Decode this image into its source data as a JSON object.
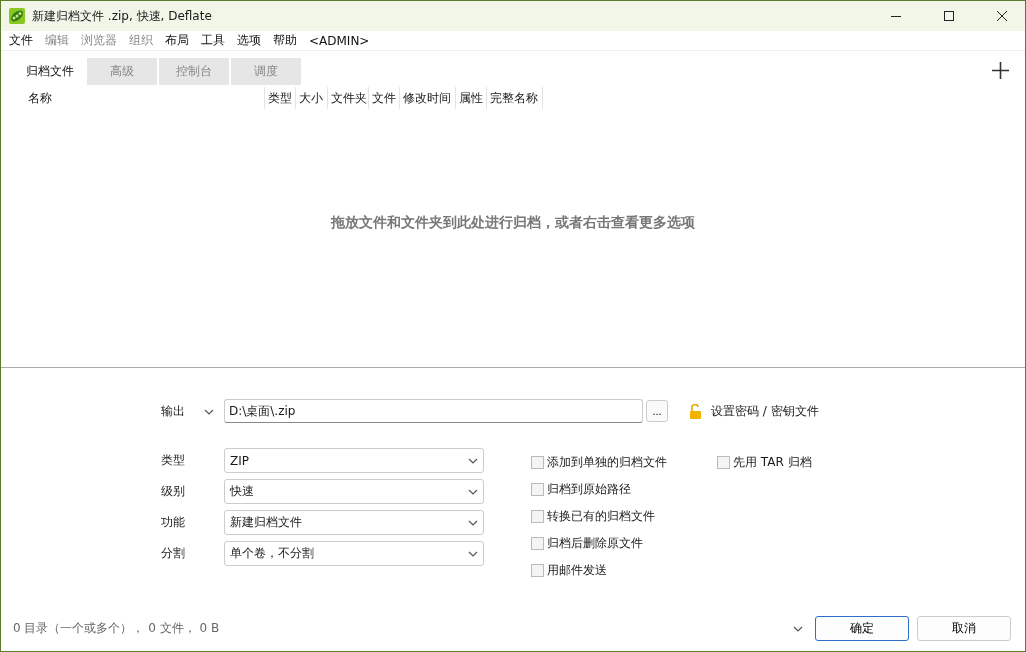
{
  "window": {
    "title": "新建归档文件 .zip, 快速, Deflate"
  },
  "menu": [
    {
      "label": "文件",
      "disabled": false
    },
    {
      "label": "编辑",
      "disabled": true
    },
    {
      "label": "浏览器",
      "disabled": true
    },
    {
      "label": "组织",
      "disabled": true
    },
    {
      "label": "布局",
      "disabled": false
    },
    {
      "label": "工具",
      "disabled": false
    },
    {
      "label": "选项",
      "disabled": false
    },
    {
      "label": "帮助",
      "disabled": false
    },
    {
      "label": "<ADMIN>",
      "disabled": false
    }
  ],
  "tabs": [
    {
      "label": "归档文件",
      "selected": true
    },
    {
      "label": "高级",
      "selected": false
    },
    {
      "label": "控制台",
      "selected": false
    },
    {
      "label": "调度",
      "selected": false
    }
  ],
  "table": {
    "columns": [
      "名称",
      "类型",
      "大小",
      "文件夹",
      "文件",
      "修改时间",
      "属性",
      "完整名称"
    ],
    "empty_message": "拖放文件和文件夹到此处进行归档，或者右击查看更多选项"
  },
  "output": {
    "label": "输出",
    "value": "D:\\桌面\\.zip",
    "browse": "...",
    "password": "设置密码 / 密钥文件"
  },
  "settings": [
    {
      "label": "类型",
      "value": "ZIP"
    },
    {
      "label": "级别",
      "value": "快速"
    },
    {
      "label": "功能",
      "value": "新建归档文件"
    },
    {
      "label": "分割",
      "value": "单个卷，不分割"
    }
  ],
  "options": [
    {
      "label": "添加到单独的归档文件",
      "checked": false
    },
    {
      "label": "归档到原始路径",
      "checked": false
    },
    {
      "label": "转换已有的归档文件",
      "checked": false
    },
    {
      "label": "归档后删除原文件",
      "checked": false
    },
    {
      "label": "用邮件发送",
      "checked": false
    }
  ],
  "extra_options": [
    {
      "label": "先用 TAR 归档",
      "checked": false
    }
  ],
  "status": "0 目录（一个或多个）， 0 文件， 0 B",
  "buttons": [
    {
      "label": "确定",
      "selected": true
    },
    {
      "label": "取消",
      "selected": false
    }
  ]
}
